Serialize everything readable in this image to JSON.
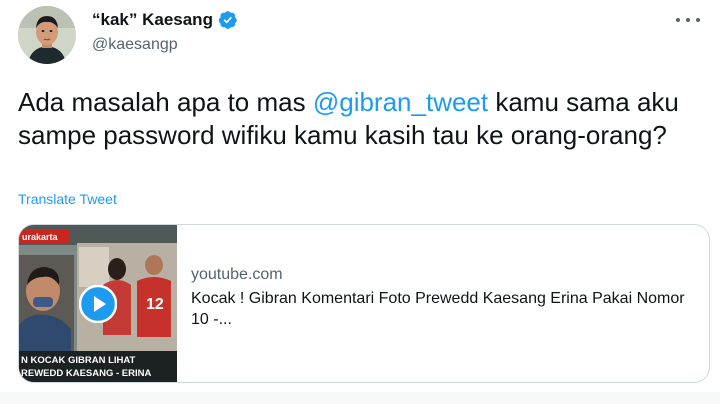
{
  "tweet": {
    "display_name": "“kak” Kaesang",
    "handle": "@kaesangp",
    "text_before": "Ada masalah apa to mas ",
    "mention": "@gibran_tweet",
    "text_after": " kamu sama aku sampe password wifiku kamu kasih tau ke orang-orang?",
    "translate_label": "Translate Tweet"
  },
  "card": {
    "domain": "youtube.com",
    "title": "Kocak ! Gibran Komentari Foto Prewedd Kaesang Erina Pakai Nomor 10 -...",
    "thumb_caption_line1": "N KOCAK GIBRAN LIHAT",
    "thumb_caption_line2": "REWEDD KAESANG - ERINA",
    "thumb_tag": "urakarta",
    "jersey_number": "12"
  },
  "colors": {
    "link": "#1d9bf0",
    "text": "#0f1419",
    "muted": "#536471",
    "border": "#cfd9de",
    "play_button": "#1d9bf0"
  },
  "icons": [
    "verified-badge-icon",
    "more-options-icon",
    "play-icon"
  ]
}
